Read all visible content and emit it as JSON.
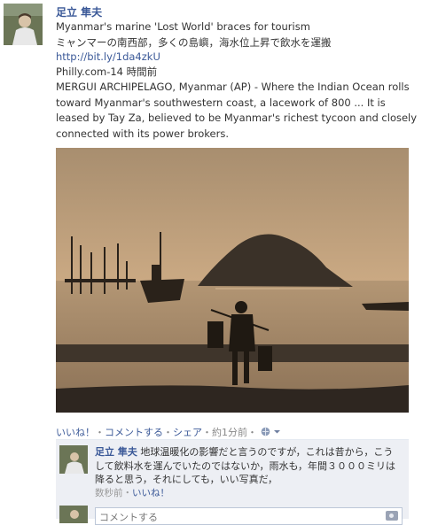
{
  "post": {
    "author": "足立 隼夫",
    "line1": "Myanmar's marine 'Lost World' braces for tourism",
    "line2": "ミャンマーの南西部，多くの島嶼，海水位上昇で飲水を運搬",
    "link": "http://bit.ly/1da4zkU",
    "source": "Philly.com-14 時間前",
    "snippet": "MERGUI ARCHIPELAGO, Myanmar (AP) - Where the Indian Ocean rolls toward Myanmar's southwestern coast, a lacework of 800 ... It is leased by Tay Za, believed to be Myanmar's richest tycoon and closely connected with its power brokers."
  },
  "actions": {
    "like": "いいね！",
    "comment": "コメントする",
    "share": "シェア",
    "time": "約1分前",
    "sep": "・"
  },
  "comment": {
    "author": "足立 隼夫",
    "text": "地球温暖化の影響だと言うのですが，これは昔から，こうして飲料水を運んでいたのではないか，雨水も，年間３０００ミリは降ると思う，それにしても，いい写真だ，",
    "time": "数秒前",
    "like": "いいね！"
  },
  "composer": {
    "placeholder": "コメントする"
  },
  "icons": [
    "globe-icon",
    "chevron-down-icon",
    "camera-icon"
  ]
}
